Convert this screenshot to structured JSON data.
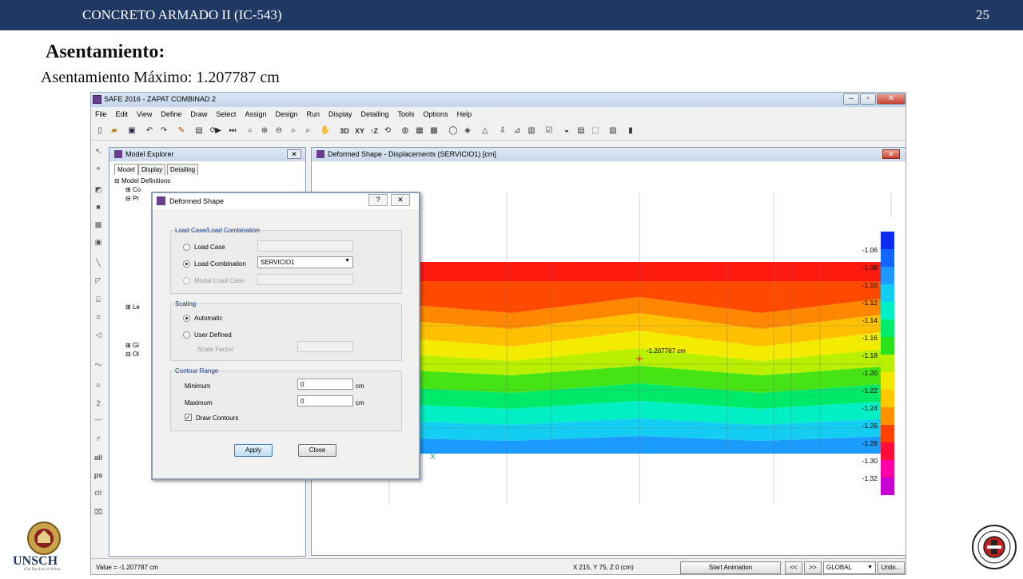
{
  "header": {
    "course": "CONCRETO ARMADO II (IC-543)",
    "page": "25"
  },
  "slide": {
    "title": "Asentamiento:",
    "subtitle": "Asentamiento Máximo: 1.207787 cm"
  },
  "app": {
    "title": "SAFE 2016 - ZAPAT COMBINAD 2",
    "menu": [
      "File",
      "Edit",
      "View",
      "Define",
      "Draw",
      "Select",
      "Assign",
      "Design",
      "Run",
      "Display",
      "Detailing",
      "Tools",
      "Options",
      "Help"
    ],
    "toolbar": {
      "label_3d": "3D",
      "label_xy": "XY",
      "label_z": "↑Z"
    },
    "left_tools": {
      "all": "all",
      "ps": "ps",
      "clr": "clr",
      "num": "2"
    }
  },
  "explorer": {
    "title": "Model Explorer",
    "close": "✕",
    "tabs": [
      "Model",
      "Display",
      "Detailing"
    ],
    "tree": {
      "root": "Model Definitions",
      "co": "Co",
      "pr": "Pr",
      "le": "Le",
      "gr": "Gl",
      "ot": "Ol"
    }
  },
  "viewport": {
    "title": "Deformed Shape - Displacements (SERVICIO1)  [cm]",
    "close": "✕",
    "point_label": "-1.207787 cm",
    "axis_label": "X",
    "legend": [
      "-1.06",
      "-1.08",
      "-1.10",
      "-1.12",
      "-1.14",
      "-1.16",
      "-1.18",
      "-1.20",
      "-1.22",
      "-1.24",
      "-1.26",
      "-1.28",
      "-1.30",
      "-1.32"
    ],
    "legend_colors": [
      "#0a2cf0",
      "#1266ff",
      "#1c98ff",
      "#12cdf2",
      "#00f0c8",
      "#00ec6c",
      "#2ce21a",
      "#b8f000",
      "#f2e800",
      "#ffc800",
      "#ff9000",
      "#ff4000",
      "#ff0e3a",
      "#ff00a8",
      "#c800d6"
    ]
  },
  "dialog": {
    "title": "Deformed Shape",
    "help": "?",
    "close": "✕",
    "load_group": "Load Case/Load Combination",
    "load_case": "Load Case",
    "load_combo": "Load Combination",
    "combo_value": "SERVICIO1",
    "modal_case": "Modal Load Case",
    "scaling_group": "Scaling",
    "automatic": "Automatic",
    "user_defined": "User Defined",
    "scale_factor": "Scale Factor",
    "contour_group": "Contour Range",
    "minimum": "Minimum",
    "maximum": "Maximum",
    "min_value": "0",
    "max_value": "0",
    "unit_min": "cm",
    "unit_max": "cm",
    "draw_contours": "Draw Contours",
    "check_mark": "✓",
    "apply": "Apply",
    "close_btn": "Close"
  },
  "status": {
    "value": "Value = -1.207787 cm",
    "coords": "X 215,  Y 75,  Z 0  (cm)",
    "start_animation": "Start Animation",
    "prev": "<<",
    "next": ">>",
    "coord_system": "GLOBAL",
    "units": "Units..."
  },
  "logos": {
    "left_text": "UNSCH",
    "left_motto": "Fiat Pax Lux et Veritas"
  }
}
